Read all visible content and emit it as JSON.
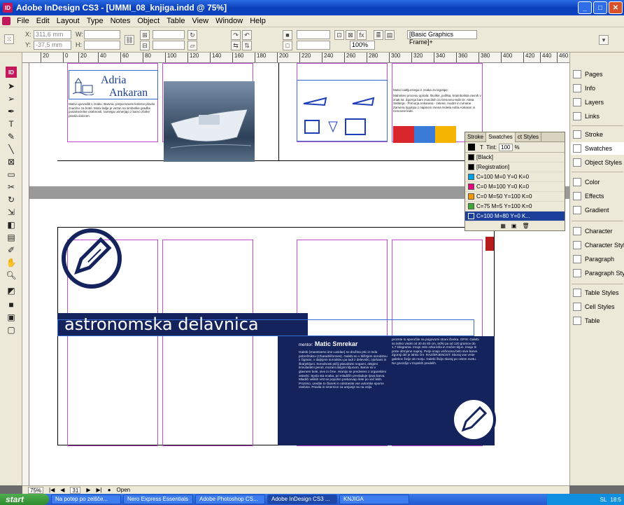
{
  "window": {
    "title": "Adobe InDesign CS3 - [UMMI_08_knjiga.indd @ 75%]"
  },
  "menu": [
    "File",
    "Edit",
    "Layout",
    "Type",
    "Notes",
    "Object",
    "Table",
    "View",
    "Window",
    "Help"
  ],
  "control": {
    "x_label": "X:",
    "x_value": "311,6 mm",
    "y_label": "Y:",
    "y_value": "-37,5 mm",
    "w_label": "W:",
    "h_label": "H:",
    "zoom_pct": "100%",
    "frame_style": "[Basic Graphics Frame]+"
  },
  "ruler": [
    "20",
    "0",
    "20",
    "40",
    "60",
    "80",
    "100",
    "120",
    "140",
    "160",
    "180",
    "200",
    "220",
    "240",
    "260",
    "280",
    "300",
    "320",
    "340",
    "360",
    "380",
    "400",
    "420",
    "440",
    "460"
  ],
  "document": {
    "logo_line1": "Adria",
    "logo_line2": "Ankaran",
    "top_left_text": "Motivi upovoditi v znaku. Barvna, prepoznavne kolorne plovilo znacilno za hotel. Motiv ladje je vezan na simbolike gradbe posamezelne osebnosti, ravnega usmerjajo z barvo zbirke plovila dolocen.",
    "top_right_heading": "Motivi nakljucnega iz znaka za logotipe:",
    "top_right_text": "Mahnitev procesu opirala: školike, poštka, kraimbolista ravnih v znak ist. Zgornja barv znacilnih za Cenovno-lede Dr. Aleta Seblerja - Primorja Ankarana - zelene, modre in rumene. Zamena logotipa z napisom imena Hotela Adria Ankaran in Cenovne lede.",
    "headline": "astronomska delavnica",
    "mentor_label": "mentor:",
    "mentor_name": "Matic Smrekar",
    "body_col1": "Galebi (znanstveno ime Laridae) so družina ptic iz reda pobrežnikov (Charadriiformes). Galebi so v bližnjem sorodstvu s čigrami, v daljnjem sorodstvu pa tudi z delevniki, njorkami in škarjekljuni. Sorodnosti ptičji plavalnimi nogami, delgimi krivulastimi peruti, mozani dolgimi kljunom. Barve so v glavnem bele, sive in črne. Hranijo se predvsem z organskimi ostanki. Spola sta enaka, pri mladičih prevladuje rjava barva. Mladiči velikih vrst se popolno prebarvajo šele po več letih. Prozimo, uredite to članek in odstranite vse avtorske sporne vsebine. Pravila in smernice za urejanje so na voljo.",
    "body_col2": "proznte to sporočite na pogovorni strani članka. OPIS: Galebi so lahko visoki od 30 do 80 cm, težki pa od 120 gramov do 1,7 kilograma. Imajo zelo ozka krila in močen kljun. Imajo tri prste obrnjene naprej. Perje imajo večinoma belo sive barve. Zgornji del je lahko črn. RAZŠIRJENOST: Skoraj vse vrste galebov živijo ob morju. Galebi živijo skoraj po celem svetu. Ne gnezdijo v tropskih predelih."
  },
  "right_panel": [
    {
      "id": "pages",
      "label": "Pages"
    },
    {
      "id": "info",
      "label": "Info"
    },
    {
      "id": "layers",
      "label": "Layers"
    },
    {
      "id": "links",
      "label": "Links"
    },
    {
      "id": "stroke",
      "label": "Stroke"
    },
    {
      "id": "swatches",
      "label": "Swatches"
    },
    {
      "id": "object-styles",
      "label": "Object Styles"
    },
    {
      "id": "color",
      "label": "Color"
    },
    {
      "id": "effects",
      "label": "Effects"
    },
    {
      "id": "gradient",
      "label": "Gradient"
    },
    {
      "id": "character",
      "label": "Character"
    },
    {
      "id": "character-styles",
      "label": "Character Styles"
    },
    {
      "id": "paragraph",
      "label": "Paragraph"
    },
    {
      "id": "paragraph-styles",
      "label": "Paragraph Styles"
    },
    {
      "id": "table-styles",
      "label": "Table Styles"
    },
    {
      "id": "cell-styles",
      "label": "Cell Styles"
    },
    {
      "id": "table",
      "label": "Table"
    }
  ],
  "swatches_panel": {
    "tabs": [
      "Stroke",
      "Swatches",
      "ct Styles"
    ],
    "tint_label": "Tint:",
    "tint_value": "100",
    "tint_unit": "%",
    "items": [
      {
        "name": "[Black]",
        "color": "#000000"
      },
      {
        "name": "[Registration]",
        "color": "#000000"
      },
      {
        "name": "C=100 M=0 Y=0 K=0",
        "color": "#00a0e9"
      },
      {
        "name": "C=0 M=100 Y=0 K=0",
        "color": "#e4007f"
      },
      {
        "name": "C=0 M=50 Y=100 K=0",
        "color": "#f39800"
      },
      {
        "name": "C=75 M=5 Y=100 K=0",
        "color": "#3aa935"
      },
      {
        "name": "C=100 M=80 Y=0 K...",
        "color": "#1b3f9a"
      }
    ]
  },
  "status": {
    "zoom": "75%",
    "page": "31",
    "state": "Open"
  },
  "taskbar": {
    "start": "start",
    "tasks": [
      "Na potep po zelšče...",
      "Nero Express Essentials",
      "Adobe Photoshop CS...",
      "Adobe InDesign CS3 ...",
      "KNJIGA"
    ],
    "lang": "SL",
    "clock": "18:5"
  },
  "colors": {
    "ink_blue": "#15235c",
    "guide_magenta": "#c04dd0",
    "frame_blue": "#3a6cd6"
  }
}
